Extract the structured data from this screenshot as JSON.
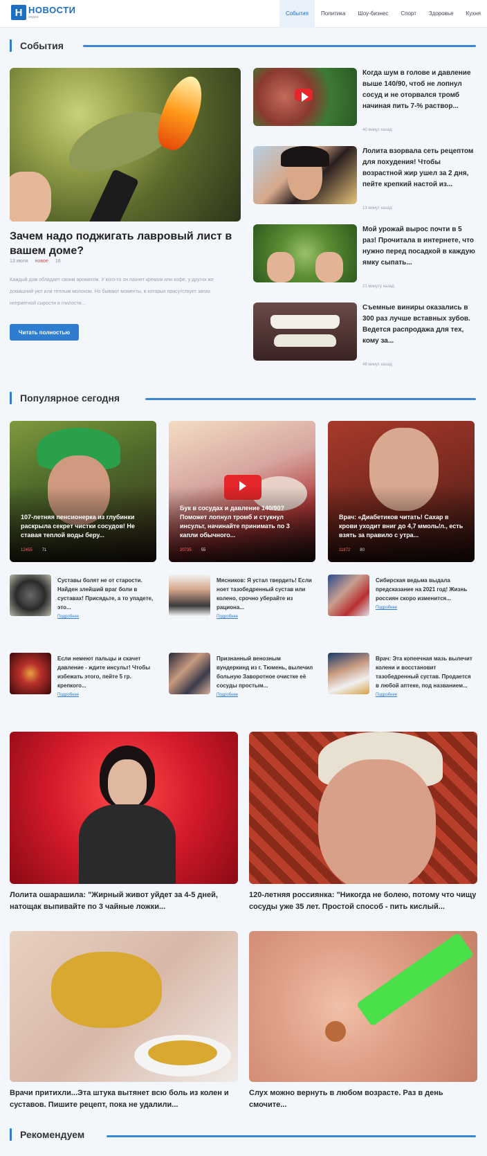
{
  "header": {
    "logo_letter": "Н",
    "logo_name": "НОВОСТИ",
    "logo_sub": "медиа",
    "nav": [
      "События",
      "Политика",
      "Шоу-бизнес",
      "Спорт",
      "Здоровье",
      "Кухня"
    ]
  },
  "sections": {
    "events": "События",
    "popular": "Популярное сегодня",
    "recommend": "Рекомендуем"
  },
  "featured": {
    "title": "Зачем надо поджигать лавровый лист в вашем доме?",
    "date": "13 июля",
    "badge": "новое",
    "comments": "16",
    "excerpt": "Каждый дом обладает своим ароматом. У кого-то он пахнет кремом или кофе, у других же домашний уют или теплым молоком. Но бывают моменты, в которых присутствует запах неприятной сырости и гнилости...",
    "button": "Читать полностью"
  },
  "side_news": [
    {
      "title": "Когда шум в голове и давление выше 140/90, чтоб не лопнул сосуд и не оторвался тромб начиная пить 7-% раствор...",
      "time": "40 минут назад"
    },
    {
      "title": "Лолита взорвала сеть рецептом для похудения! Чтобы возрастной жир ушел за 2 дня, пейте крепкий настой из...",
      "time": "13 минут назад"
    },
    {
      "title": "Мой урожай вырос почти в 5 раз! Прочитала в интернете, что нужно перед посадкой в каждую ямку сыпать...",
      "time": "21 минуту назад"
    },
    {
      "title": "Съемные виниры оказались в 300 раз лучше вставных зубов. Ведется распродажа для тех, кому за...",
      "time": "46 минут назад"
    }
  ],
  "popular": [
    {
      "title": "107-летняя пенсионерка из глубинки раскрыла секрет чистки сосудов! Не ставая теплой воды беру...",
      "views": "12455",
      "comments": "71"
    },
    {
      "title": "Бук в сосудах и давление 140/90? Поможет лопнул тромб и стукнул инсульт, начинайте принимать по 3 капли обычного...",
      "views": "20735",
      "comments": "55"
    },
    {
      "title": "Врач: «Диабетиков читать! Сахар в крови уходит вниг до 4,7 ммоль/л., есть взять за правило с утра...",
      "views": "11872",
      "comments": "80"
    }
  ],
  "small_news": [
    {
      "text": "Суставы болят не от старости. Найден злейший враг боли в суставах! Присядьте, а то упадете, это...",
      "more": "Подробнее"
    },
    {
      "text": "Мясников: Я устал твердить! Если ноет тазобедренный сустав или колено, срочно уберайте из рациона...",
      "more": "Подробнее"
    },
    {
      "text": "Сибирская ведьма выдала предсказание на 2021 год! Жизнь россиян скоро изменится...",
      "more": "Подробнее"
    },
    {
      "text": "Если немеют пальцы и скачет давление - ждите инсульт! Чтобы избежать этого, пейте 5 гр. крепкого...",
      "more": "Подробнее"
    },
    {
      "text": "Признанный венозным вундеркинд из г. Тюмень, вылечил больную Заворотное очистке её сосуды простым...",
      "more": "Подробнее"
    },
    {
      "text": "Врач: Эта копеечная мазь вылечит колени и восстановит тазобедренный сустав. Продается в любой аптеке, под названием...",
      "more": "Подробнее"
    }
  ],
  "big_news": [
    {
      "title": "Лолита ошарашила: \"Жирный живот уйдет за 4-5 дней, натощак выпивайте по 3 чайные ложки..."
    },
    {
      "title": "120-летняя россиянка: \"Никогда не болею, потому что чищу сосуды уже 35 лет. Простой способ - пить кислый..."
    },
    {
      "title": "Врачи притихли...Эта штука вытянет всю боль из колен и суставов. Пишите рецепт, пока не удалили..."
    },
    {
      "title": "Слух можно вернуть в любом возрасте. Раз в день смочите..."
    }
  ]
}
